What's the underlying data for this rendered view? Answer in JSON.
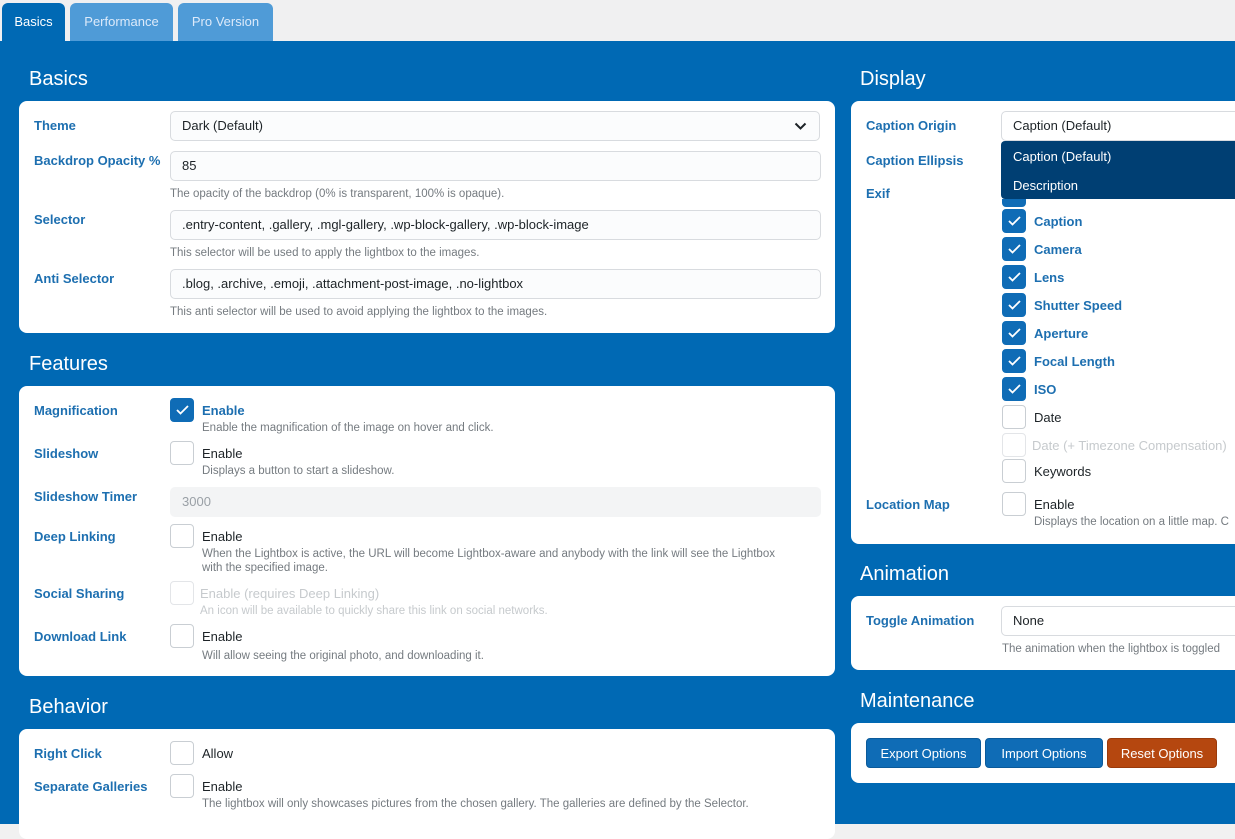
{
  "tabs": [
    {
      "label": "Basics",
      "active": true
    },
    {
      "label": "Performance",
      "active": false
    },
    {
      "label": "Pro Version",
      "active": false
    }
  ],
  "basics": {
    "title": "Basics",
    "theme": {
      "label": "Theme",
      "value": "Dark (Default)"
    },
    "backdrop": {
      "label": "Backdrop Opacity %",
      "value": "85",
      "hint": "The opacity of the backdrop (0% is transparent, 100% is opaque)."
    },
    "selector": {
      "label": "Selector",
      "value": ".entry-content, .gallery, .mgl-gallery, .wp-block-gallery,  .wp-block-image",
      "hint": "This selector will be used to apply the lightbox to the images."
    },
    "anti_selector": {
      "label": "Anti Selector",
      "value": ".blog, .archive, .emoji, .attachment-post-image, .no-lightbox",
      "hint": "This anti selector will be used to avoid applying the lightbox to the images."
    }
  },
  "features": {
    "title": "Features",
    "magnification": {
      "label": "Magnification",
      "option": "Enable",
      "checked": true,
      "hint": "Enable the magnification of the image on hover and click."
    },
    "slideshow": {
      "label": "Slideshow",
      "option": "Enable",
      "checked": false,
      "hint": "Displays a button to start a slideshow."
    },
    "slideshow_timer": {
      "label": "Slideshow Timer",
      "value": "3000"
    },
    "deep_linking": {
      "label": "Deep Linking",
      "option": "Enable",
      "checked": false,
      "hint1": "When the Lightbox is active, the URL will become Lightbox-aware and anybody with the link will see the Lightbox",
      "hint2": "with the specified image."
    },
    "social_sharing": {
      "label": "Social Sharing",
      "option": "Enable (requires Deep Linking)",
      "checked": false,
      "hint": "An icon will be available to quickly share this link on social networks."
    },
    "download_link": {
      "label": "Download Link",
      "option": "Enable",
      "checked": false,
      "hint": "Will allow seeing the original photo, and downloading it."
    }
  },
  "behavior": {
    "title": "Behavior",
    "right_click": {
      "label": "Right Click",
      "option": "Allow",
      "checked": false
    },
    "separate_galleries": {
      "label": "Separate Galleries",
      "option": "Enable",
      "checked": false,
      "hint": "The lightbox will only showcases pictures from the chosen gallery. The galleries are defined by the Selector."
    }
  },
  "display": {
    "title": "Display",
    "caption_origin": {
      "label": "Caption Origin",
      "value": "Caption (Default)"
    },
    "caption_ellipsis": {
      "label": "Caption Ellipsis"
    },
    "dropdown_options": [
      "Caption (Default)",
      "Description"
    ],
    "exif": {
      "label": "Exif",
      "items": [
        {
          "label": "Caption",
          "checked": true
        },
        {
          "label": "Camera",
          "checked": true
        },
        {
          "label": "Lens",
          "checked": true
        },
        {
          "label": "Shutter Speed",
          "checked": true
        },
        {
          "label": "Aperture",
          "checked": true
        },
        {
          "label": "Focal Length",
          "checked": true
        },
        {
          "label": "ISO",
          "checked": true
        },
        {
          "label": "Date",
          "checked": false
        },
        {
          "label": "Date (+ Timezone Compensation)",
          "checked": false,
          "disabled": true
        },
        {
          "label": "Keywords",
          "checked": false
        }
      ]
    },
    "location_map": {
      "label": "Location Map",
      "option": "Enable",
      "checked": false,
      "hint": "Displays the location on a little map. C"
    }
  },
  "animation": {
    "title": "Animation",
    "toggle": {
      "label": "Toggle Animation",
      "value": "None",
      "hint": "The animation when the lightbox is toggled"
    }
  },
  "maintenance": {
    "title": "Maintenance",
    "export_label": "Export Options",
    "import_label": "Import Options",
    "reset_label": "Reset Options"
  },
  "colors": {
    "primary": "#0069b4",
    "label_blue": "#1d6fb0",
    "reset_red": "#b5470f",
    "dropdown_bg": "#003f73"
  }
}
